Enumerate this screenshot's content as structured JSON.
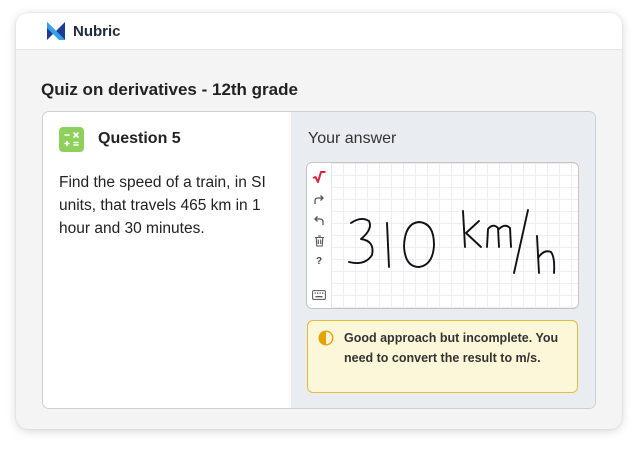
{
  "app": {
    "brand": "Nubric"
  },
  "quiz": {
    "title": "Quiz on derivatives - 12th grade"
  },
  "question": {
    "label": "Question 5",
    "text": "Find the speed of a train, in SI units, that travels 465 km in 1 hour and 30 minutes.",
    "icon": "calculator-icon"
  },
  "answer": {
    "label": "Your answer",
    "handwritten_value": "310 km/h",
    "tools": [
      "square-root-icon",
      "redo-icon",
      "undo-icon",
      "trash-icon",
      "help-icon",
      "keyboard-icon"
    ]
  },
  "feedback": {
    "text": "Good approach but incomplete. You need to convert the result to m/s.",
    "icon": "half-circle-icon",
    "colors": {
      "background": "#fdf7d9",
      "border": "#e3bd36",
      "icon": "#e3a300"
    }
  },
  "colors": {
    "accent": "#8fcf5b",
    "brand": "#1e2a3a",
    "logo_dark": "#1f3a93",
    "logo_light": "#2fa3ea"
  }
}
